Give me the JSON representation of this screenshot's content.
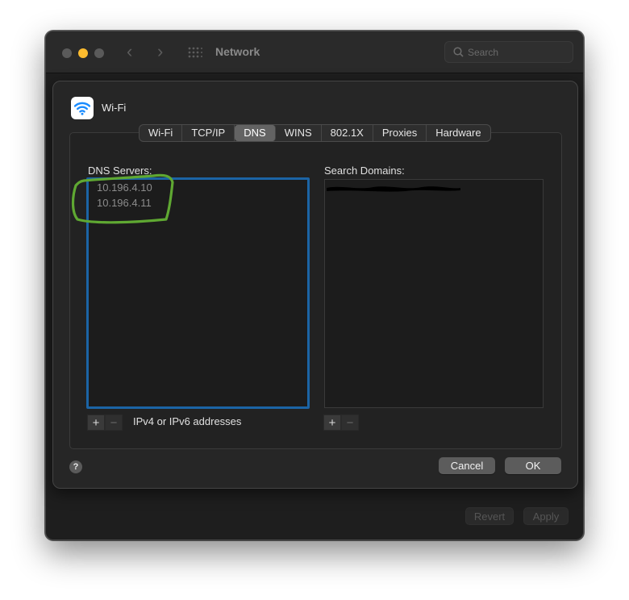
{
  "window": {
    "title": "Network",
    "search_placeholder": "Search",
    "revert_label": "Revert",
    "apply_label": "Apply"
  },
  "sheet": {
    "service_name": "Wi-Fi",
    "tabs": [
      {
        "label": "Wi-Fi",
        "active": false
      },
      {
        "label": "TCP/IP",
        "active": false
      },
      {
        "label": "DNS",
        "active": true
      },
      {
        "label": "WINS",
        "active": false
      },
      {
        "label": "802.1X",
        "active": false
      },
      {
        "label": "Proxies",
        "active": false
      },
      {
        "label": "Hardware",
        "active": false
      }
    ],
    "dns_servers_label": "DNS Servers:",
    "dns_servers": [
      "10.196.4.10",
      "10.196.4.11"
    ],
    "search_domains_label": "Search Domains:",
    "hint": "IPv4 or IPv6 addresses",
    "add_symbol": "+",
    "remove_symbol": "−",
    "help_symbol": "?",
    "cancel_label": "Cancel",
    "ok_label": "OK"
  },
  "icons": {
    "service": "wifi-icon",
    "search": "search-icon",
    "grid": "grid-icon",
    "back": "chevron-left-icon",
    "forward": "chevron-right-icon"
  },
  "colors": {
    "accent_focus": "#1b64a5",
    "minimize_light": "#fdbc2f",
    "annotation": "#5fa832",
    "wifi_blue": "#1a8cff"
  }
}
